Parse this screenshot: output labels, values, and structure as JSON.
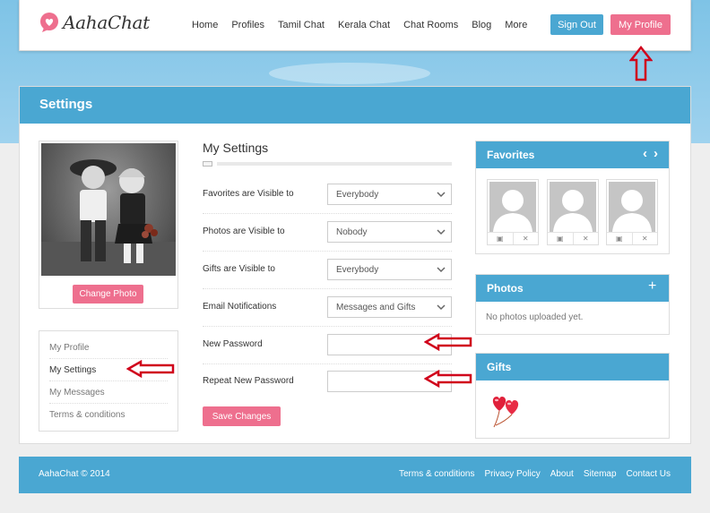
{
  "brand": {
    "name": "AahaChat"
  },
  "nav": {
    "items": [
      "Home",
      "Profiles",
      "Tamil Chat",
      "Kerala Chat",
      "Chat Rooms",
      "Blog",
      "More"
    ]
  },
  "header_buttons": {
    "sign_out": "Sign Out",
    "my_profile": "My Profile"
  },
  "page": {
    "title": "Settings"
  },
  "profile": {
    "change_photo": "Change Photo"
  },
  "side_menu": {
    "items": [
      "My Profile",
      "My Settings",
      "My Messages",
      "Terms & conditions"
    ],
    "active": "My Settings"
  },
  "settings": {
    "title": "My Settings",
    "rows": [
      {
        "label": "Favorites are Visible to",
        "type": "select",
        "value": "Everybody"
      },
      {
        "label": "Photos are Visible to",
        "type": "select",
        "value": "Nobody"
      },
      {
        "label": "Gifts are Visible to",
        "type": "select",
        "value": "Everybody"
      },
      {
        "label": "Email Notifications",
        "type": "select",
        "value": "Messages and Gifts"
      },
      {
        "label": "New Password",
        "type": "password",
        "value": ""
      },
      {
        "label": "Repeat New Password",
        "type": "password",
        "value": ""
      }
    ],
    "save_label": "Save Changes"
  },
  "favorites": {
    "title": "Favorites",
    "prev": "‹",
    "next": "›",
    "count": 3
  },
  "photos": {
    "title": "Photos",
    "add": "+",
    "empty_text": "No photos uploaded yet."
  },
  "gifts": {
    "title": "Gifts"
  },
  "footer": {
    "copyright": "AahaChat © 2014",
    "links": [
      "Terms & conditions",
      "Privacy Policy",
      "About",
      "Sitemap",
      "Contact Us"
    ]
  },
  "colors": {
    "primary": "#4aa7d2",
    "accent": "#ee6f8e",
    "annotation": "#d0021b"
  }
}
